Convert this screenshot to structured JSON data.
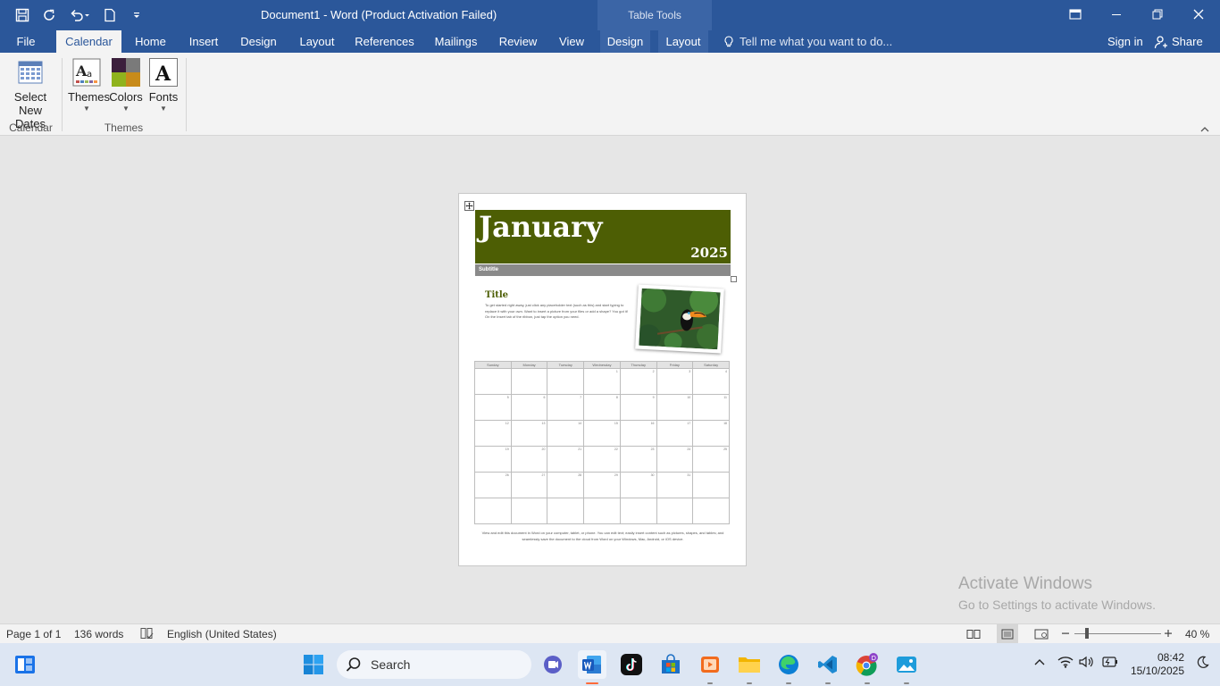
{
  "window": {
    "title": "Document1 - Word (Product Activation Failed)",
    "table_tools": "Table Tools"
  },
  "tabs": [
    {
      "label": "File"
    },
    {
      "label": "Calendar"
    },
    {
      "label": "Home"
    },
    {
      "label": "Insert"
    },
    {
      "label": "Design"
    },
    {
      "label": "Layout"
    },
    {
      "label": "References"
    },
    {
      "label": "Mailings"
    },
    {
      "label": "Review"
    },
    {
      "label": "View"
    },
    {
      "label": "Design"
    },
    {
      "label": "Layout"
    }
  ],
  "tell_me": "Tell me what you want to do...",
  "sign_in": "Sign in",
  "share": "Share",
  "ribbon": {
    "select_dates_1": "Select",
    "select_dates_2": "New Dates",
    "themes": "Themes",
    "colors": "Colors",
    "fonts": "Fonts",
    "group_calendar": "Calendar",
    "group_themes": "Themes"
  },
  "doc": {
    "month": "January",
    "year": "2025",
    "subtitle": "Subtitle",
    "title": "Title",
    "body": "To get started right away, just click any placeholder text (such as this) and start typing to replace it with your own. Want to insert a picture from your files or add a shape? You got it! On the Insert tab of the ribbon, just tap the option you need.",
    "days": [
      "Sunday",
      "Monday",
      "Tuesday",
      "Wednesday",
      "Thursday",
      "Friday",
      "Saturday"
    ],
    "weeks": [
      [
        "",
        "",
        "",
        "1",
        "2",
        "3",
        "4"
      ],
      [
        "5",
        "6",
        "7",
        "8",
        "9",
        "10",
        "11"
      ],
      [
        "12",
        "13",
        "14",
        "15",
        "16",
        "17",
        "18"
      ],
      [
        "19",
        "20",
        "21",
        "22",
        "23",
        "24",
        "25"
      ],
      [
        "26",
        "27",
        "28",
        "29",
        "30",
        "31",
        ""
      ],
      [
        "",
        "",
        "",
        "",
        "",
        "",
        ""
      ]
    ],
    "footer": "View and edit this document in Word on your computer, tablet, or phone. You can edit text; easily insert content such as pictures, shapes, and tables; and seamlessly save the document to the cloud from Word on your Windows, Mac, Android, or iOS device."
  },
  "activate": {
    "line1": "Activate Windows",
    "line2": "Go to Settings to activate Windows."
  },
  "status": {
    "page": "Page 1 of 1",
    "words": "136 words",
    "language": "English (United States)",
    "zoom": "40 %",
    "zoom_fraction": 0.4
  },
  "taskbar": {
    "search": "Search",
    "time": "08:42",
    "date": "15/10/2025"
  },
  "colors": {
    "word_blue": "#2b579a",
    "banner_green": "#4d5e04"
  }
}
